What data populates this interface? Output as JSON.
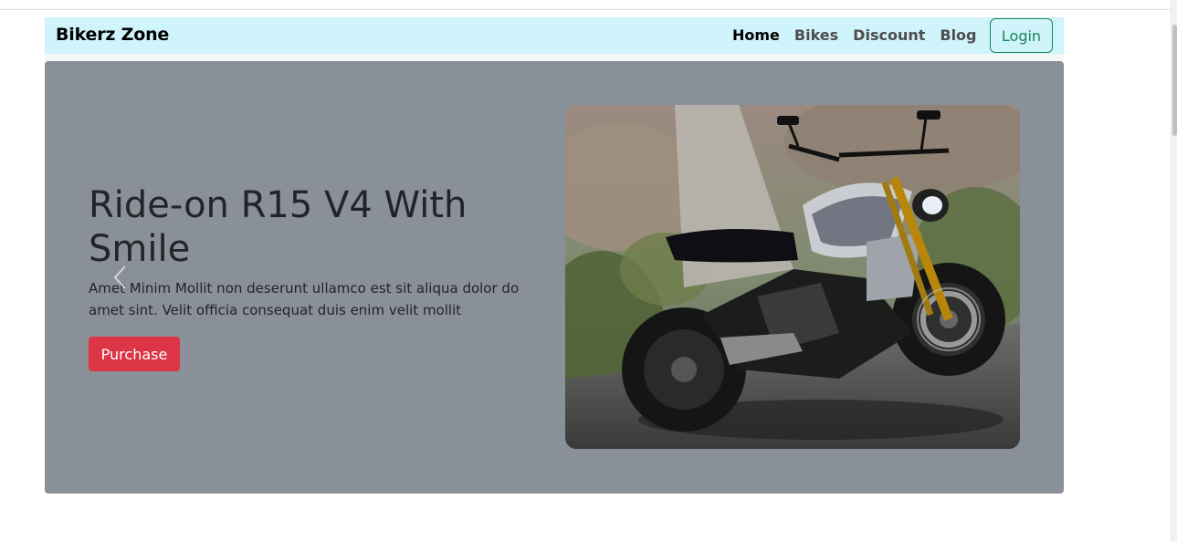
{
  "navbar": {
    "brand": "Bikerz Zone",
    "links": [
      "Home",
      "Bikes",
      "Discount",
      "Blog"
    ],
    "active_link": "Home",
    "login_label": "Login",
    "background": "#cff4fc",
    "login_color": "#198754"
  },
  "hero": {
    "title": "Ride-on R15 V4 With Smile",
    "text": "Amet Minim Mollit non deserunt ullamco est sit aliqua dolor do amet sint. Velit officia consequat duis enim velit mollit",
    "purchase_label": "Purchase",
    "background": "#8a9097",
    "purchase_color": "#dc3545",
    "prev_icon": "chevron-left-icon",
    "image": "motorcycle-photo"
  }
}
